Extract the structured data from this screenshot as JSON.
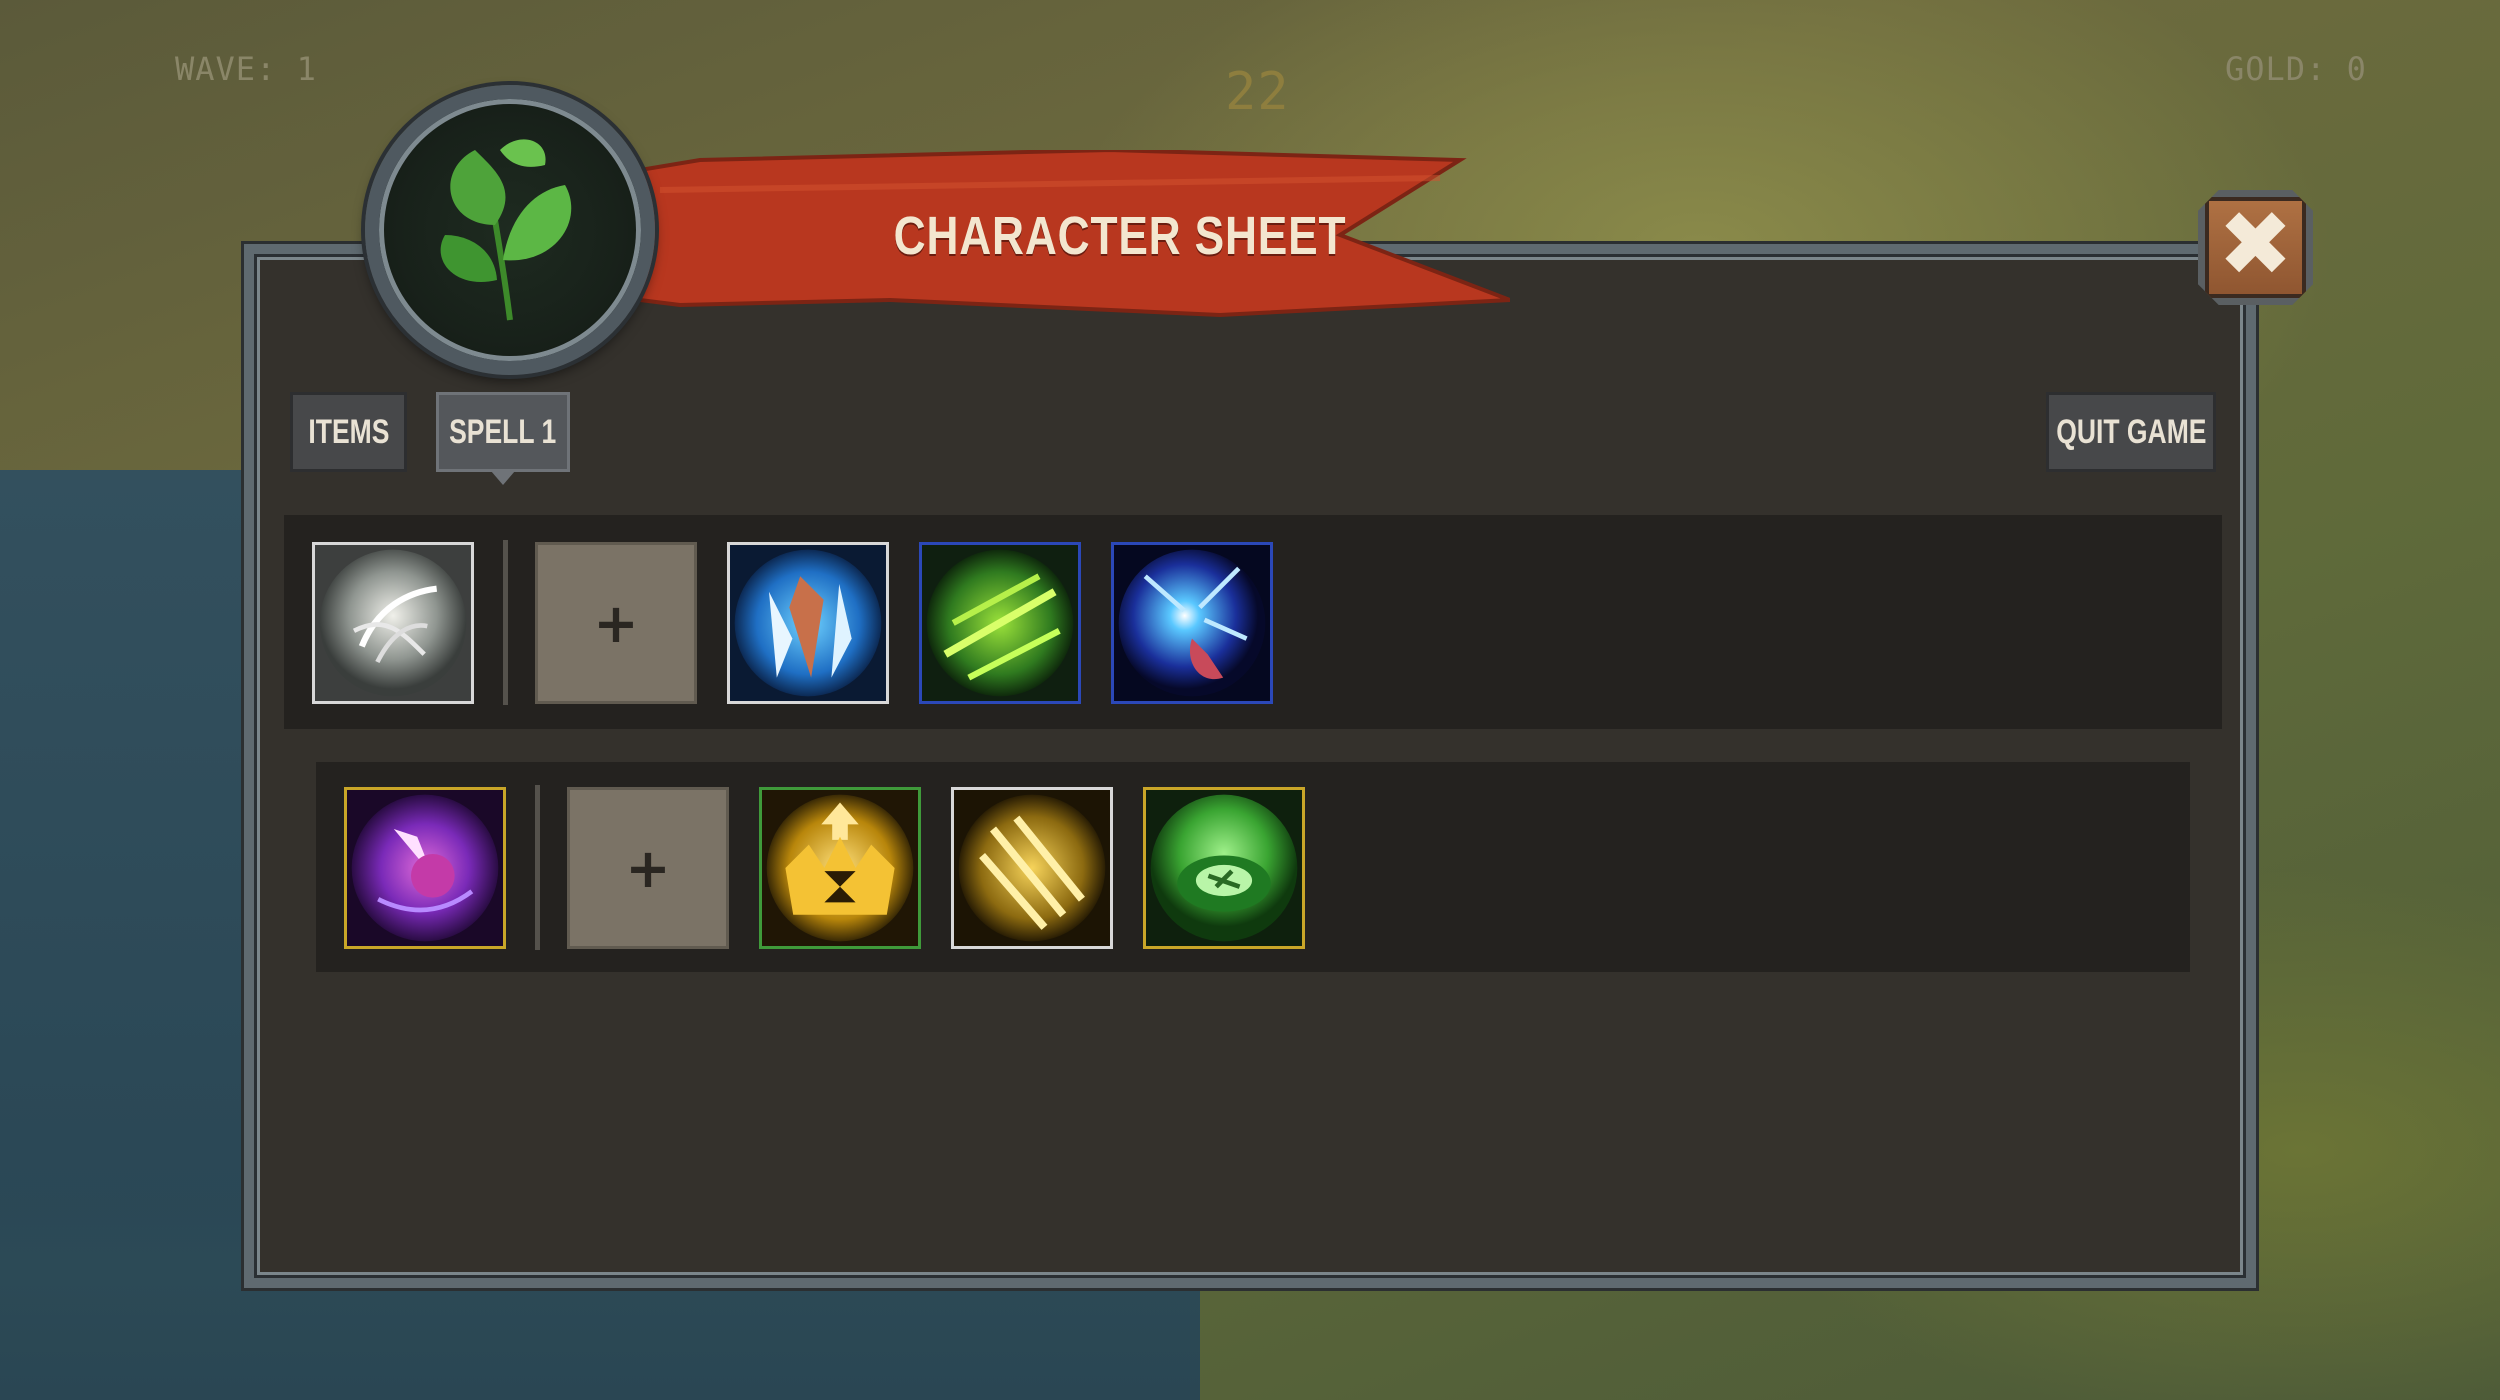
{
  "hud": {
    "wave": "WAVE: 1",
    "timer": "22",
    "gold": "GOLD: 0"
  },
  "header": {
    "title": "CHARACTER SHEET",
    "emblem_icon": "leaf-icon",
    "close_icon": "close-icon",
    "close_symbol": "✖"
  },
  "tabs": [
    {
      "label": "ITEMS",
      "active": false
    },
    {
      "label": "SPELL 1",
      "active": true
    }
  ],
  "quit_label": "QUIT GAME",
  "add_slot_symbol": "+",
  "rows": [
    {
      "primary": {
        "icon": "whirlwind-spell-icon",
        "border": "#d8d8d8"
      },
      "slots": [
        {
          "icon": "ice-shard-spell-icon",
          "border": "#d8d8d8"
        },
        {
          "icon": "green-slash-spell-icon",
          "border": "#2b48b8"
        },
        {
          "icon": "arcane-blast-spell-icon",
          "border": "#2b48b8"
        }
      ]
    },
    {
      "primary": {
        "icon": "void-rune-spell-icon",
        "border": "#c9a628"
      },
      "slots": [
        {
          "icon": "golden-crown-upgrade-icon",
          "border": "#3f9a3a"
        },
        {
          "icon": "golden-claw-upgrade-icon",
          "border": "#d8d8d8"
        },
        {
          "icon": "green-vortex-upgrade-icon",
          "border": "#c9a628"
        }
      ]
    }
  ]
}
